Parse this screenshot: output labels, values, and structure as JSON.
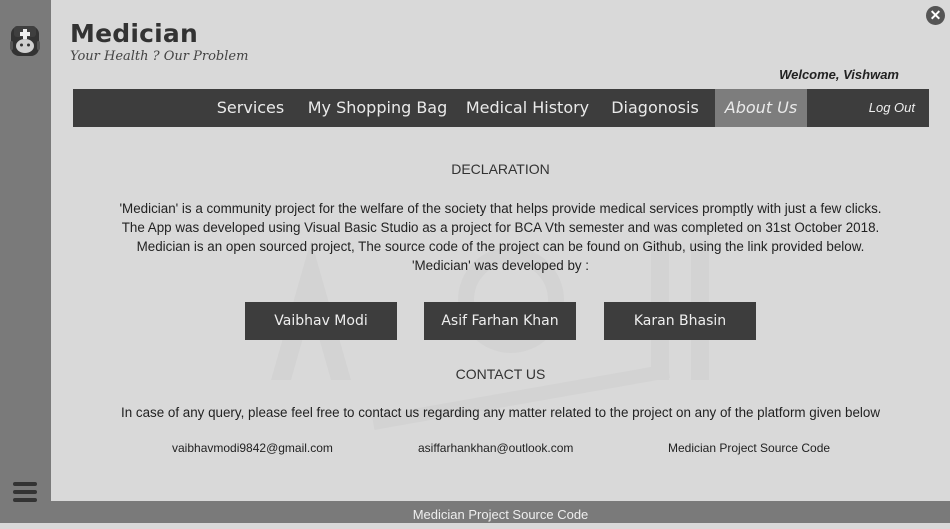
{
  "brand": {
    "title": "Medician",
    "tagline": "Your Health ? Our Problem"
  },
  "header": {
    "welcome": "Welcome, Vishwam"
  },
  "nav": {
    "items": [
      {
        "label": "Services"
      },
      {
        "label": "My Shopping Bag"
      },
      {
        "label": "Medical History"
      },
      {
        "label": "Diagonosis"
      },
      {
        "label": "About Us"
      }
    ],
    "active": "About Us",
    "logout": "Log Out"
  },
  "declaration": {
    "heading": "DECLARATION",
    "lines": [
      "'Medician' is a community project for the welfare of the society that helps provide medical services promptly with just a few clicks.",
      "The App was developed using Visual Basic Studio as a project for BCA Vth semester and was completed on 31st October 2018.",
      "Medician is an open sourced project, The source code of the project can be found on Github, using the link provided below.",
      "'Medician' was developed by :"
    ]
  },
  "developers": [
    "Vaibhav Modi",
    "Asif Farhan Khan",
    "Karan Bhasin"
  ],
  "contact": {
    "heading": "CONTACT US",
    "text": "In case of any query, please feel free to contact us regarding any matter related to the project on any of the platform given below",
    "links": [
      "vaibhavmodi9842@gmail.com",
      "asiffarhankhan@outlook.com",
      "Medician Project Source Code"
    ]
  },
  "footer": {
    "label": "Medician Project Source Code"
  },
  "colors": {
    "background": "#d9d9d9",
    "sidebar": "#7a7a7a",
    "nav": "#3d3d3d",
    "nav_active": "#7d7d7d"
  },
  "icons": {
    "app": "doctor-icon",
    "close": "close-icon",
    "menu": "hamburger-menu-icon"
  }
}
